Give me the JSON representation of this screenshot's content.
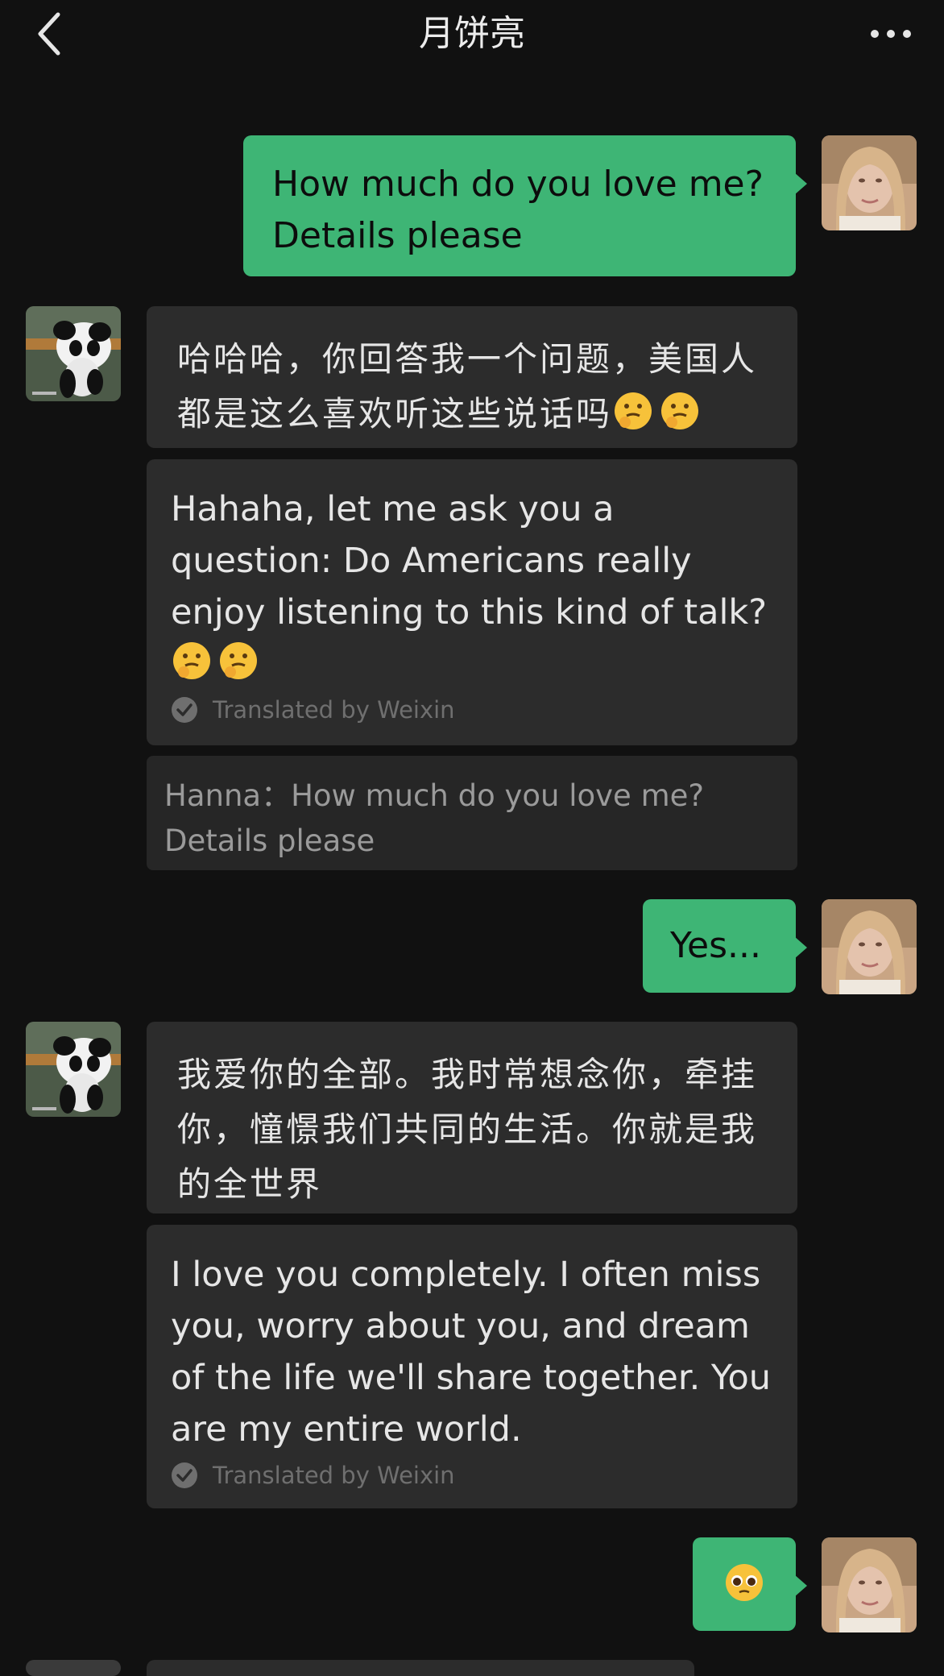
{
  "header": {
    "title": "月饼亮",
    "back_icon": "chevron-left-icon",
    "more_icon": "more-dots-icon"
  },
  "colors": {
    "background": "#111111",
    "my_bubble": "#3eb575",
    "their_bubble": "#2c2c2c",
    "quote_bg": "#262626"
  },
  "messages": {
    "m1_text": "How much do you love me? Details please",
    "m2_zh": "哈哈哈，你回答我一个问题，美国人都是这么喜欢听这些说话吗",
    "m2_en": "Hahaha, let me ask you a question: Do Americans really enjoy listening to this kind of talk?",
    "m2_translated": "Translated by Weixin",
    "m2_quote": "Hanna：How much do you love me? Details please",
    "m3_text": "Yes...",
    "m4_zh": "我爱你的全部。我时常想念你，牵挂你，憧憬我们共同的生活。你就是我的全世界",
    "m4_en": "I love you completely. I often miss you, worry about you, and dream of the life we'll share together. You are my entire world.",
    "m4_translated": "Translated by Weixin",
    "m5_emoji": "pleading-face-emoji"
  }
}
